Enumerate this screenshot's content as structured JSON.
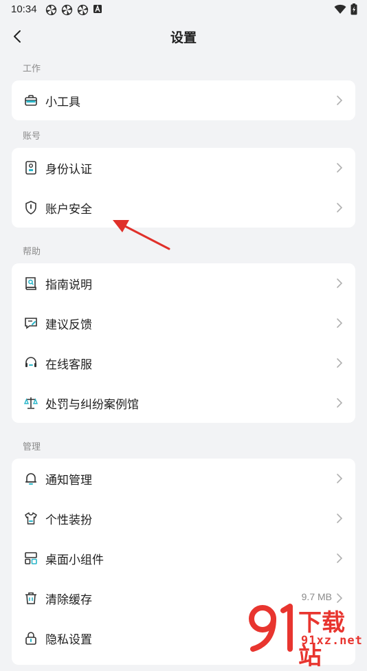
{
  "status_bar": {
    "time": "10:34",
    "left_icons": [
      "pinwheel-icon",
      "pinwheel-icon",
      "pinwheel-icon",
      "a-badge-icon"
    ],
    "right_icons": [
      "wifi-icon",
      "battery-charging-icon"
    ]
  },
  "header": {
    "title": "设置",
    "back_icon": "chevron-left-icon"
  },
  "sections": [
    {
      "label": "工作",
      "items": [
        {
          "label": "小工具",
          "icon": "toolbox-icon"
        }
      ]
    },
    {
      "label": "账号",
      "items": [
        {
          "label": "身份认证",
          "icon": "id-badge-icon"
        },
        {
          "label": "账户安全",
          "icon": "shield-icon"
        }
      ]
    },
    {
      "label": "帮助",
      "items": [
        {
          "label": "指南说明",
          "icon": "guide-book-icon"
        },
        {
          "label": "建议反馈",
          "icon": "feedback-icon"
        },
        {
          "label": "在线客服",
          "icon": "headset-icon"
        },
        {
          "label": "处罚与纠纷案例馆",
          "icon": "scales-icon"
        }
      ]
    },
    {
      "label": "管理",
      "items": [
        {
          "label": "通知管理",
          "icon": "bell-icon"
        },
        {
          "label": "个性装扮",
          "icon": "shirt-icon"
        },
        {
          "label": "桌面小组件",
          "icon": "widgets-icon"
        },
        {
          "label": "清除缓存",
          "icon": "trash-icon",
          "value": "9.7 MB"
        },
        {
          "label": "隐私设置",
          "icon": "lock-icon"
        }
      ]
    }
  ],
  "annotation": {
    "color": "#e0302a"
  },
  "watermark": {
    "text_top": "下载站",
    "text_bottom": "91xz.net",
    "logo": "91-logo",
    "color": "#e8352f"
  },
  "colors": {
    "background": "#f2f3f5",
    "card": "#ffffff",
    "label": "#8a8a8a",
    "text": "#1f1f1f"
  }
}
